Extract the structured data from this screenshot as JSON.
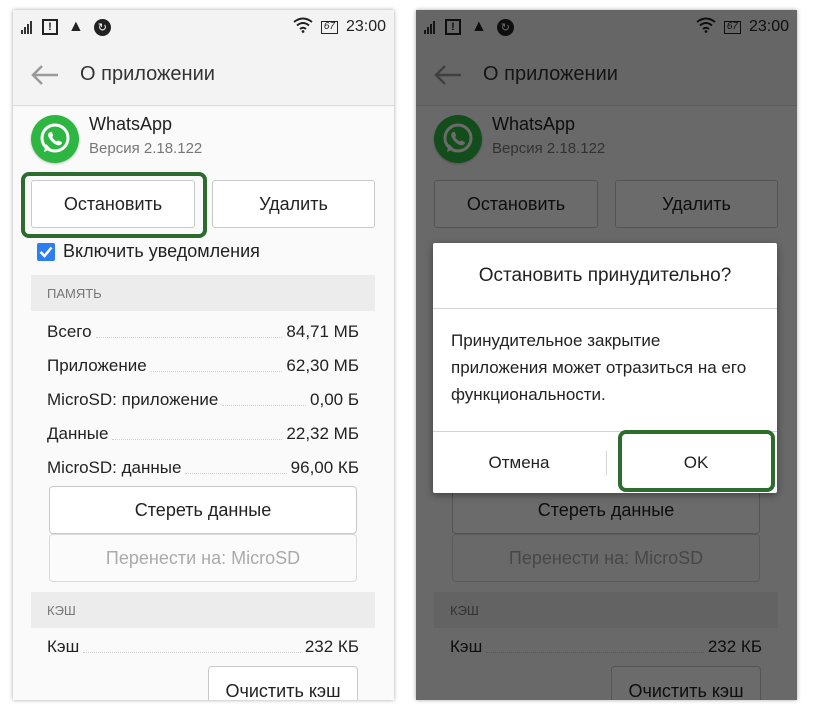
{
  "status_bar": {
    "time": "23:00",
    "battery": "67"
  },
  "app_bar": {
    "title": "О приложении"
  },
  "app": {
    "name": "WhatsApp",
    "version": "Версия 2.18.122"
  },
  "buttons": {
    "stop": "Остановить",
    "delete": "Удалить"
  },
  "notifications": {
    "label": "Включить уведомления",
    "checked": true
  },
  "memory": {
    "header": "ПАМЯТЬ",
    "rows": [
      {
        "label": "Всего",
        "value": "84,71 МБ"
      },
      {
        "label": "Приложение",
        "value": "62,30 МБ"
      },
      {
        "label": "MicroSD: приложение",
        "value": "0,00 Б"
      },
      {
        "label": "Данные",
        "value": "22,32 МБ"
      },
      {
        "label": "MicroSD: данные",
        "value": "96,00 КБ"
      }
    ],
    "clear_data": "Стереть данные",
    "move_to": "Перенести на: MicroSD"
  },
  "cache": {
    "header": "КЭШ",
    "label": "Кэш",
    "value": "232 КБ",
    "clear_cache": "Очистить кэш"
  },
  "dialog": {
    "title": "Остановить принудительно?",
    "message": "Принудительное закрытие приложения может отразиться на его функциональности.",
    "cancel": "Отмена",
    "ok": "OK"
  },
  "colors": {
    "highlight": "#2e6b2f",
    "whatsapp_green": "#2db742",
    "checkbox": "#2d7ff0"
  }
}
